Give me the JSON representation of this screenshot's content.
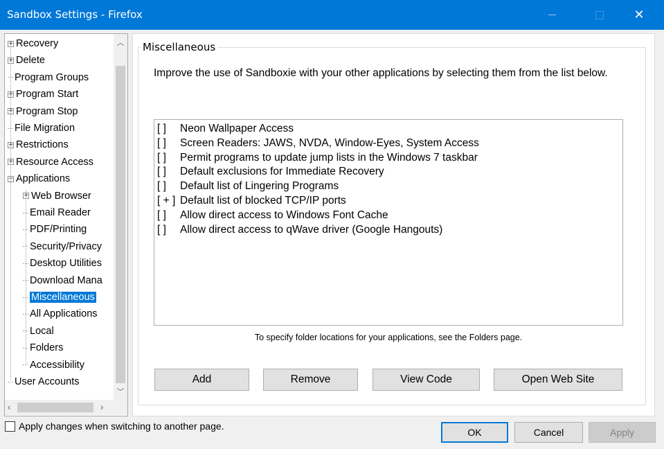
{
  "window": {
    "title": "Sandbox Settings - Firefox"
  },
  "tree": {
    "items": [
      {
        "label": "Recovery",
        "expander": "+"
      },
      {
        "label": "Delete",
        "expander": "+"
      },
      {
        "label": "Program Groups",
        "expander": ""
      },
      {
        "label": "Program Start",
        "expander": "+"
      },
      {
        "label": "Program Stop",
        "expander": "+"
      },
      {
        "label": "File Migration",
        "expander": ""
      },
      {
        "label": "Restrictions",
        "expander": "+"
      },
      {
        "label": "Resource Access",
        "expander": "+"
      },
      {
        "label": "Applications",
        "expander": "−"
      },
      {
        "label": "Web Browser",
        "expander": "+"
      },
      {
        "label": "Email Reader",
        "expander": ""
      },
      {
        "label": "PDF/Printing",
        "expander": ""
      },
      {
        "label": "Security/Privacy",
        "expander": ""
      },
      {
        "label": "Desktop Utilities",
        "expander": ""
      },
      {
        "label": "Download Mana",
        "expander": ""
      },
      {
        "label": "Miscellaneous",
        "expander": ""
      },
      {
        "label": "All Applications",
        "expander": ""
      },
      {
        "label": "Local",
        "expander": ""
      },
      {
        "label": "Folders",
        "expander": ""
      },
      {
        "label": "Accessibility",
        "expander": ""
      },
      {
        "label": "User Accounts",
        "expander": ""
      }
    ],
    "selected": "Miscellaneous"
  },
  "panel": {
    "title": "Miscellaneous",
    "description": "Improve the use of Sandboxie with your other applications by selecting them from the list below.",
    "list": [
      {
        "mark": "[   ]",
        "label": "Neon Wallpaper Access"
      },
      {
        "mark": "[   ]",
        "label": "Screen Readers:  JAWS, NVDA, Window-Eyes, System Access"
      },
      {
        "mark": "[   ]",
        "label": "Permit programs to update jump lists in the Windows 7 taskbar"
      },
      {
        "mark": "[   ]",
        "label": "Default exclusions for Immediate Recovery"
      },
      {
        "mark": "[   ]",
        "label": "Default list of Lingering Programs"
      },
      {
        "mark": "[ + ]",
        "label": "Default list of blocked TCP/IP ports"
      },
      {
        "mark": "[   ]",
        "label": "Allow direct access to Windows Font Cache"
      },
      {
        "mark": "[   ]",
        "label": "Allow direct access to qWave driver (Google Hangouts)"
      }
    ],
    "hint": "To specify folder locations for your applications, see the Folders page.",
    "buttons": {
      "add": "Add",
      "remove": "Remove",
      "view_code": "View Code",
      "open_web_site": "Open Web Site"
    }
  },
  "footer": {
    "apply_on_switch_label": "Apply changes when switching to another page.",
    "ok": "OK",
    "cancel": "Cancel",
    "apply": "Apply"
  }
}
